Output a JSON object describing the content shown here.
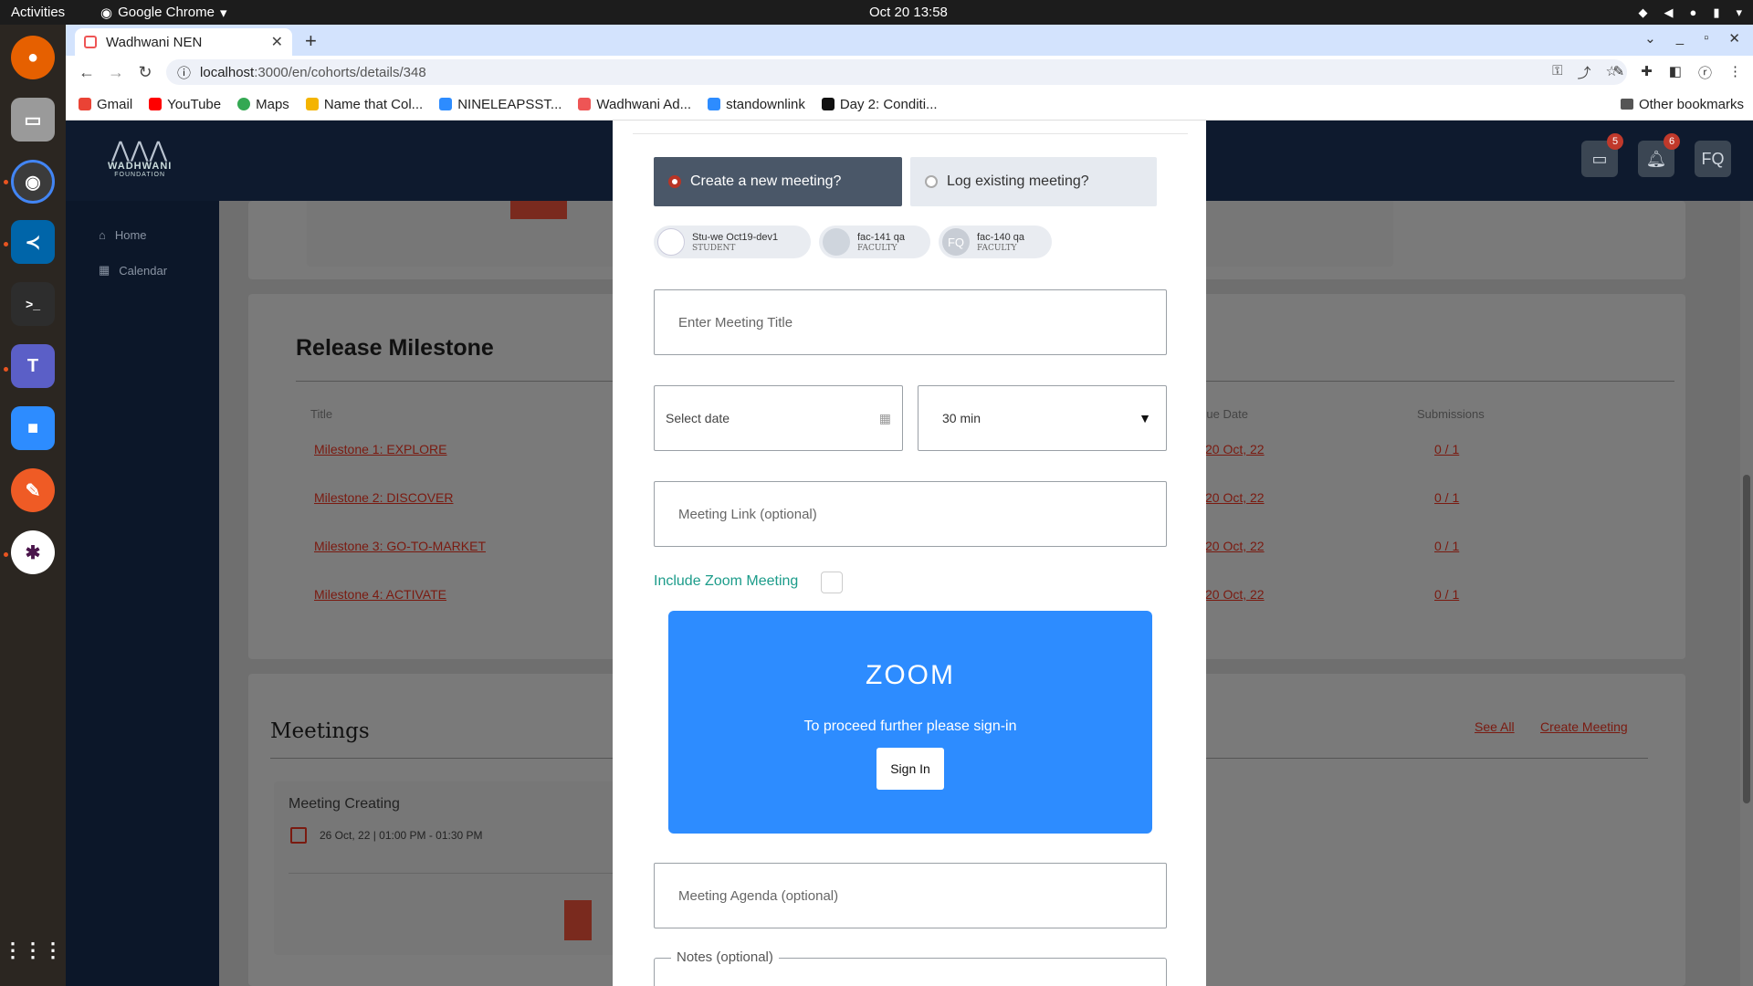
{
  "os": {
    "activities": "Activities",
    "app_name": "Google Chrome",
    "clock": "Oct 20  13:58"
  },
  "browser": {
    "tab_title": "Wadhwani NEN",
    "url_host": "localhost",
    "url_path": ":3000/en/cohorts/details/348",
    "bookmarks": [
      "Gmail",
      "YouTube",
      "Maps",
      "Name that Col...",
      "NINELEAPSST...",
      "Wadhwani Ad...",
      "standownlink",
      "Day 2: Conditi..."
    ],
    "bookmark_colors": [
      "#ea4335",
      "#ff0000",
      "#34a853",
      "#f4b400",
      "#2d8cff",
      "#e55",
      "#2d8cff",
      "#111"
    ],
    "other_bookmarks": "Other bookmarks"
  },
  "app": {
    "logo_text": "WADHWANI",
    "logo_sub": "FOUNDATION",
    "chat_badge": "5",
    "notif_badge": "6",
    "avatar_initials": "FQ",
    "nav": [
      "Home",
      "Calendar"
    ]
  },
  "milestones": {
    "title": "Release Milestone",
    "headers": {
      "title": "Title",
      "due": "Due Date",
      "subs": "Submissions"
    },
    "rows": [
      {
        "title": "Milestone 1: EXPLORE",
        "due": "20 Oct, 22",
        "subs": "0 / 1"
      },
      {
        "title": "Milestone 2: DISCOVER",
        "due": "20 Oct, 22",
        "subs": "0 / 1"
      },
      {
        "title": "Milestone 3: GO-TO-MARKET",
        "due": "20 Oct, 22",
        "subs": "0 / 1"
      },
      {
        "title": "Milestone 4: ACTIVATE",
        "due": "20 Oct, 22",
        "subs": "0 / 1"
      }
    ]
  },
  "meetings": {
    "title": "Meetings",
    "see_all": "See All",
    "create": "Create Meeting",
    "card_title": "Meeting Creating",
    "card_time": "26 Oct, 22 | 01:00 PM - 01:30 PM"
  },
  "modal": {
    "opt_new": "Create a new meeting?",
    "opt_existing": "Log existing meeting?",
    "participants": [
      {
        "name": "Stu-we Oct19-dev1",
        "role": "STUDENT",
        "initials": ""
      },
      {
        "name": "fac-141 qa",
        "role": "FACULTY",
        "initials": ""
      },
      {
        "name": "fac-140 qa",
        "role": "FACULTY",
        "initials": "FQ"
      }
    ],
    "title_placeholder": "Enter Meeting Title",
    "date_placeholder": "Select date",
    "duration": "30 min",
    "link_placeholder": "Meeting Link (optional)",
    "zoom_label": "Include Zoom Meeting",
    "zoom_logo": "ZOOM",
    "zoom_msg": "To proceed further please sign-in",
    "zoom_signin": "Sign In",
    "agenda_placeholder": "Meeting Agenda (optional)",
    "notes_label": "Notes (optional)",
    "colors": {
      "accent": "#b93425",
      "zoom": "#2d8cff",
      "zoom_label": "#1c9c8a"
    }
  }
}
